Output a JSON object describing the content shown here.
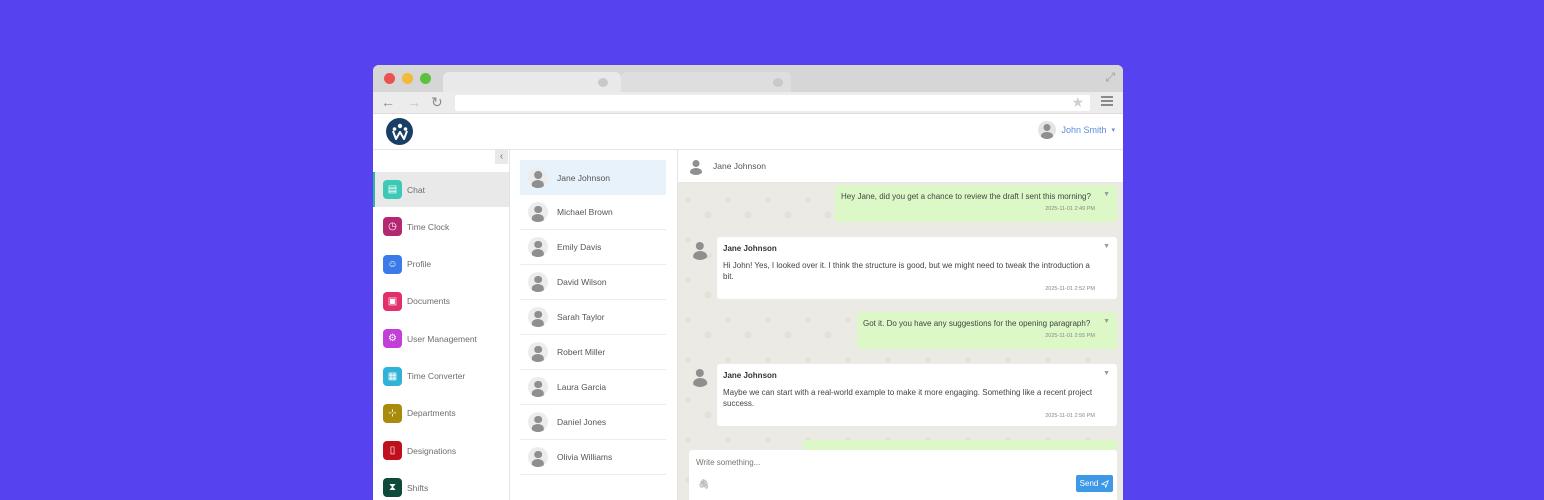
{
  "app": {
    "user_name": "John Smith",
    "caret": "▾"
  },
  "sidebar": {
    "collapse_icon": "‹",
    "items": [
      {
        "label": "Chat",
        "icon": "chat-icon",
        "color": "#3ec9b7",
        "glyph": "▤"
      },
      {
        "label": "Time Clock",
        "icon": "stopwatch-icon",
        "color": "#b42872",
        "glyph": "◷"
      },
      {
        "label": "Profile",
        "icon": "profile-icon",
        "color": "#3b7be8",
        "glyph": "☺"
      },
      {
        "label": "Documents",
        "icon": "briefcase-icon",
        "color": "#e1306c",
        "glyph": "▣"
      },
      {
        "label": "User Management",
        "icon": "user-gear-icon",
        "color": "#c340d8",
        "glyph": "⚙"
      },
      {
        "label": "Time Converter",
        "icon": "calendar-icon",
        "color": "#2fb3d9",
        "glyph": "▦"
      },
      {
        "label": "Departments",
        "icon": "sitemap-icon",
        "color": "#a88a0c",
        "glyph": "⊹"
      },
      {
        "label": "Designations",
        "icon": "id-badge-icon",
        "color": "#c0101e",
        "glyph": "▯"
      },
      {
        "label": "Shifts",
        "icon": "hourglass-icon",
        "color": "#0e4a3c",
        "glyph": "⧗"
      }
    ]
  },
  "contacts": [
    "Jane Johnson",
    "Michael Brown",
    "Emily Davis",
    "David Wilson",
    "Sarah Taylor",
    "Robert Miller",
    "Laura Garcia",
    "Daniel Jones",
    "Olivia Williams"
  ],
  "chat": {
    "contact_name": "Jane Johnson",
    "messages": [
      {
        "dir": "out",
        "text": "Hey Jane, did you get a chance to review the draft I sent this morning?",
        "time": "2025-11-01 2:49 PM"
      },
      {
        "dir": "in",
        "name": "Jane Johnson",
        "text": "Hi John! Yes, I looked over it. I think the structure is good, but we might need to tweak the introduction a bit.",
        "time": "2025-11-01 2:52 PM"
      },
      {
        "dir": "out",
        "text": "Got it. Do you have any suggestions for the opening paragraph?",
        "time": "2025-11-01 2:55 PM"
      },
      {
        "dir": "in",
        "name": "Jane Johnson",
        "text": "Maybe we can start with a real-world example to make it more engaging. Something like a recent project success.",
        "time": "2025-11-01 2:56 PM"
      }
    ],
    "composer_placeholder": "Write something...",
    "send_label": "Send"
  }
}
